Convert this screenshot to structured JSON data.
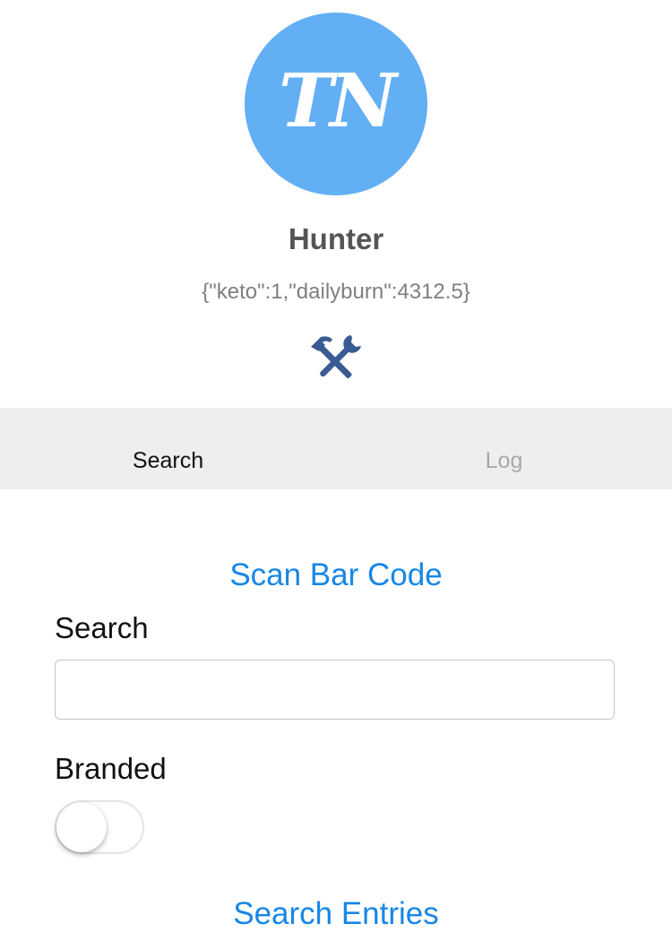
{
  "profile": {
    "logo_text": "TN",
    "name": "Hunter",
    "settings_json": "{\"keto\":1,\"dailyburn\":4312.5}",
    "tools_icon": "hammer-wrench-icon"
  },
  "tabs": [
    {
      "label": "Search",
      "active": true
    },
    {
      "label": "Log",
      "active": false
    }
  ],
  "search_panel": {
    "scan_label": "Scan Bar Code",
    "search_label": "Search",
    "search_value": "",
    "search_placeholder": "",
    "branded_label": "Branded",
    "branded_on": false,
    "submit_label": "Search Entries"
  },
  "colors": {
    "accent": "#1787e6",
    "logo_bg": "#62aff4",
    "tools_icon": "#3a5a93",
    "tabbar_bg": "#eeeeee"
  }
}
